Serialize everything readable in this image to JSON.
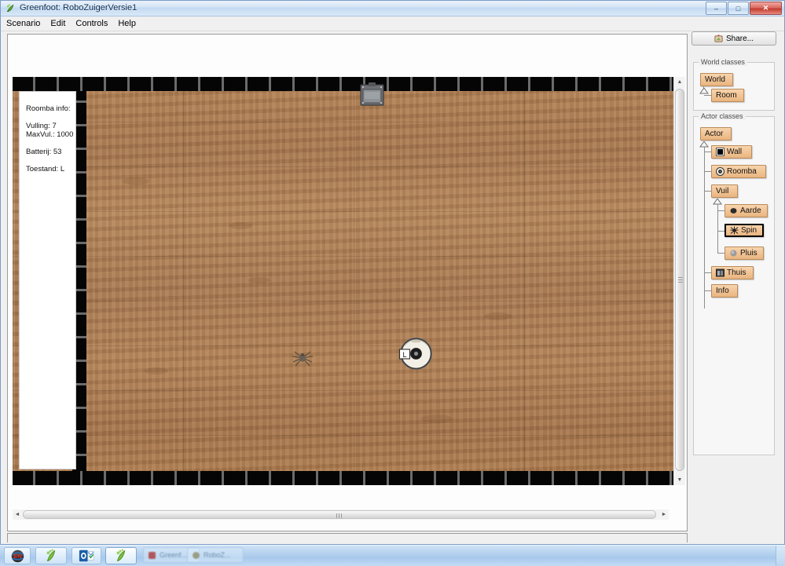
{
  "window": {
    "title": "Greenfoot: RoboZuigerVersie1",
    "app_icon": "greenfoot-icon",
    "minimize_label": "–",
    "maximize_label": "□",
    "close_label": "✕"
  },
  "menu": {
    "items": [
      {
        "label": "Scenario",
        "mnemonic": "S"
      },
      {
        "label": "Edit",
        "mnemonic": "E"
      },
      {
        "label": "Controls",
        "mnemonic": "C"
      },
      {
        "label": "Help",
        "mnemonic": "H"
      }
    ]
  },
  "toolbar": {
    "share_label": "Share...",
    "share_icon": "share-icon"
  },
  "world": {
    "info_panel": {
      "title": "Roomba info:",
      "vulling_label": "Vulling: 7",
      "maxvul_label": "MaxVul.: 1000",
      "batterij_label": "Batterij: 53",
      "toestand_label": "Toestand: L"
    },
    "actors": {
      "roomba_badge": "L",
      "roomba_name": "roomba-actor",
      "thuis_name": "thuis-actor",
      "spin_name": "spin-actor"
    },
    "scroll": {
      "up_arrow": "▲",
      "down_arrow": "▼",
      "left_arrow": "◄",
      "right_arrow": "►"
    }
  },
  "class_browser": {
    "world_group": {
      "title": "World classes",
      "classes": [
        {
          "name": "World",
          "icon": "none",
          "selected": false
        },
        {
          "name": "Room",
          "icon": "none",
          "selected": false
        }
      ]
    },
    "actor_group": {
      "title": "Actor classes",
      "classes": [
        {
          "name": "Actor",
          "icon": "none",
          "selected": false
        },
        {
          "name": "Wall",
          "icon": "black-square-icon",
          "selected": false
        },
        {
          "name": "Roomba",
          "icon": "roomba-disc-icon",
          "selected": false
        },
        {
          "name": "Vuil",
          "icon": "none",
          "selected": false
        },
        {
          "name": "Aarde",
          "icon": "dark-blob-icon",
          "selected": false
        },
        {
          "name": "Spin",
          "icon": "spider-icon",
          "selected": true
        },
        {
          "name": "Pluis",
          "icon": "gray-fuzz-icon",
          "selected": false
        },
        {
          "name": "Thuis",
          "icon": "dock-icon",
          "selected": false
        },
        {
          "name": "Info",
          "icon": "none",
          "selected": false
        }
      ]
    }
  },
  "taskbar": {
    "buttons": [
      {
        "name": "language-indicator",
        "glyph": "EN"
      },
      {
        "name": "greenfoot-taskbar-1",
        "glyph": "foot"
      },
      {
        "name": "outlook-taskbar",
        "glyph": "O"
      },
      {
        "name": "greenfoot-taskbar-2",
        "glyph": "foot"
      }
    ],
    "ghost_buttons": [
      {
        "label": "Greenf..."
      },
      {
        "label": "RoboZ..."
      }
    ]
  },
  "colors": {
    "class_box": "#f0c191",
    "class_border": "#b98b5d",
    "wall": "#050505",
    "floor_base": "#a87a52",
    "title_blue": "#0c2a4d",
    "taskbar": "#a8c9ec"
  }
}
